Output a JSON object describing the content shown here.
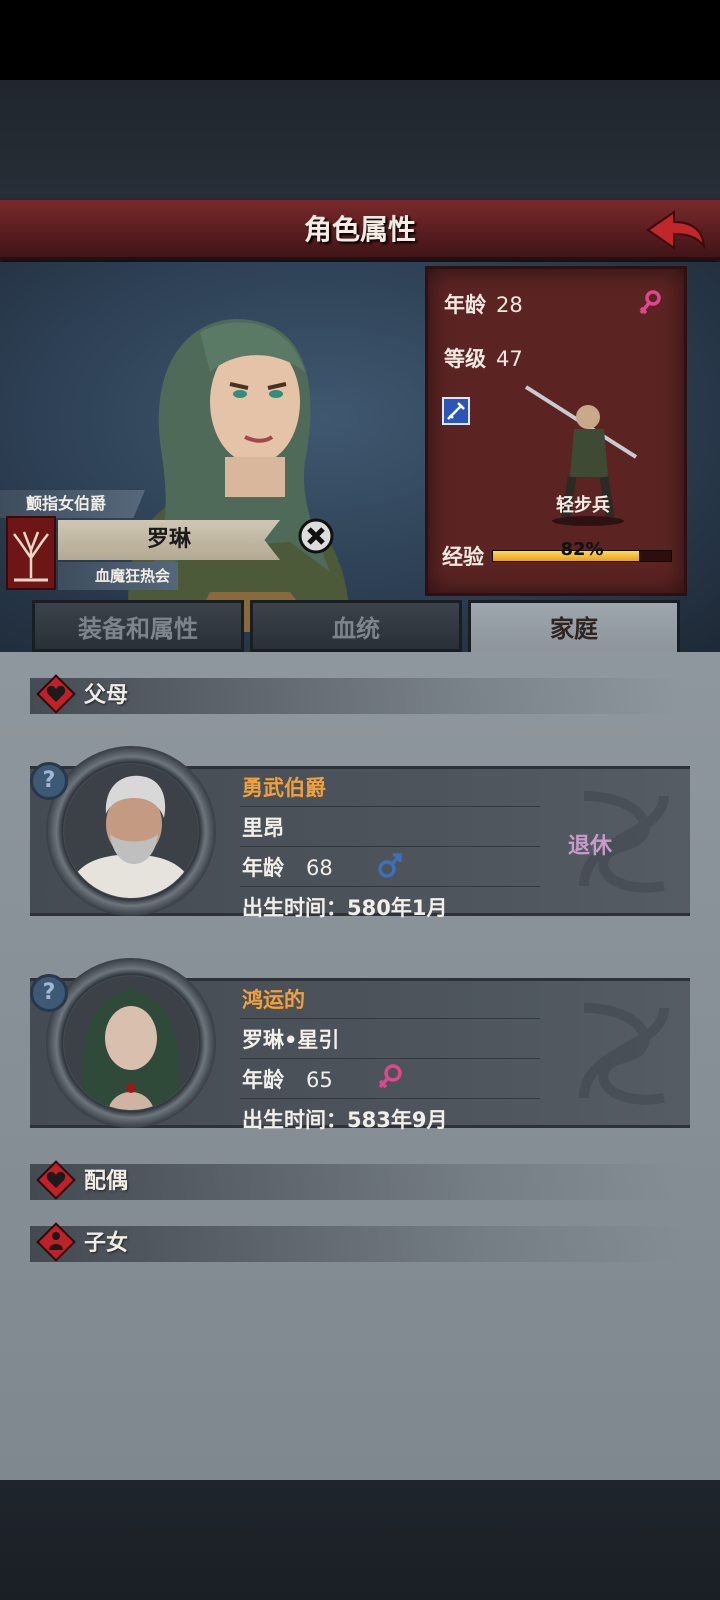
{
  "header": {
    "title": "角色属性"
  },
  "character": {
    "title": "颤指女伯爵",
    "name": "罗琳",
    "guild": "血魔狂热会",
    "stats": {
      "age_label": "年龄",
      "age": "28",
      "level_label": "等级",
      "level": "47",
      "class_name": "轻步兵",
      "xp_label": "经验",
      "xp_percent": "82%",
      "xp_fraction": 0.82,
      "gender_icon": "female-icon"
    }
  },
  "tabs": [
    {
      "label": "装备和属性",
      "active": false
    },
    {
      "label": "血统",
      "active": false
    },
    {
      "label": "家庭",
      "active": true
    }
  ],
  "family": {
    "parents_label": "父母",
    "spouse_label": "配偶",
    "children_label": "子女",
    "parents": [
      {
        "title": "勇武伯爵",
        "name": "里昂",
        "age_label": "年龄",
        "age": "68",
        "gender_icon": "male-icon",
        "birth": "出生时间：580年1月",
        "status": "退休"
      },
      {
        "title": "鸿运的",
        "name": "罗琳•星引",
        "age_label": "年龄",
        "age": "65",
        "gender_icon": "female-icon",
        "birth": "出生时间：583年9月",
        "status": ""
      }
    ]
  },
  "colors": {
    "header_red": "#6b2426",
    "accent_orange": "#f0a13c",
    "female_pink": "#e0468c",
    "male_blue": "#3e6fb8",
    "retire_purple": "#c79acb"
  }
}
